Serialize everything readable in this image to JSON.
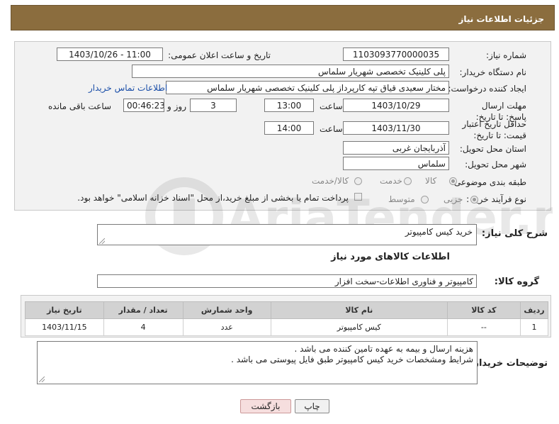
{
  "header": {
    "title": "جزئیات اطلاعات نیاز"
  },
  "form": {
    "need_number_label": "شماره نیاز:",
    "need_number": "1103093770000035",
    "announce_label": "تاریخ و ساعت اعلان عمومی:",
    "announce_value": "1403/10/26 - 11:00",
    "buyer_org_label": "نام دستگاه خریدار:",
    "buyer_org": "پلی کلینیک تخصصی شهریار سلماس",
    "creator_label": "ایجاد کننده درخواست:",
    "creator": "مختار سعیدی قیاق تپه کارپرداز پلی کلینیک تخصصی شهریار سلماس",
    "contact_link": "اطلاعات تماس خریدار",
    "deadline_label": "مهلت ارسال پاسخ: تا تاریخ:",
    "deadline_date": "1403/10/29",
    "time_label": "ساعت",
    "deadline_time": "13:00",
    "days_value": "3",
    "days_label": "روز و",
    "remaining_time": "00:46:23",
    "remaining_label": "ساعت باقی مانده",
    "validity_label": "حداقل تاریخ اعتبار قیمت: تا تاریخ:",
    "validity_date": "1403/11/30",
    "validity_time": "14:00",
    "province_label": "استان محل تحویل:",
    "province": "آذربایجان غربی",
    "city_label": "شهر محل تحویل:",
    "city": "سلماس",
    "category_label": "طبقه بندی موضوعی:",
    "category_options": [
      "کالا",
      "خدمت",
      "کالا/خدمت"
    ],
    "process_label": "نوع فرآیند خرید :",
    "process_options": [
      "جزیی",
      "متوسط"
    ],
    "payment_note": "پرداخت تمام یا بخشی از مبلغ خرید،از محل \"اسناد خزانه اسلامی\" خواهد بود."
  },
  "summary": {
    "label": "شرح کلی نیاز:",
    "value": "خرید کیس کامپیوتر"
  },
  "goods_section": {
    "title": "اطلاعات کالاهای مورد نیاز",
    "group_label": "گروه کالا:",
    "group_value": "کامپیوتر و فناوری اطلاعات-سخت افزار"
  },
  "table": {
    "headers": [
      "ردیف",
      "کد کالا",
      "نام کالا",
      "واحد شمارش",
      "تعداد / مقدار",
      "تاریخ نیاز"
    ],
    "rows": [
      [
        "1",
        "--",
        "کیس کامپیوتر",
        "عدد",
        "4",
        "1403/11/15"
      ]
    ]
  },
  "buyer_notes": {
    "label": "توضیحات خریدار:",
    "lines": [
      "هزینه ارسال و بیمه به عهده تامین کننده می باشد .",
      "شرایط ومشخصات خرید کیس کامپیوتر طبق فایل پیوستی می باشد ."
    ]
  },
  "buttons": {
    "print": "چاپ",
    "back": "بازگشت"
  },
  "watermark": {
    "text": "AriaTender.neT"
  },
  "colors": {
    "header_bg": "#8b6d3e",
    "link": "#1a4ea8",
    "back_button_bg": "#f6dede"
  }
}
